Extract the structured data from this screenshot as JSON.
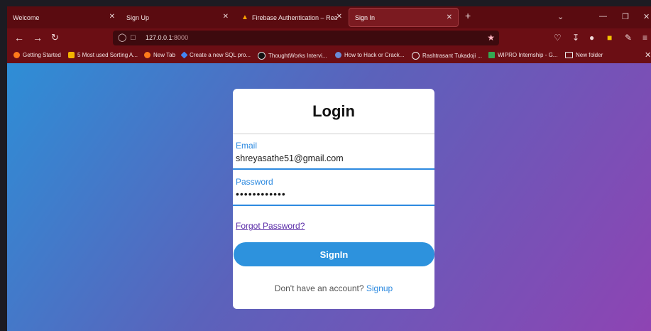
{
  "browser": {
    "tabs": [
      {
        "label": "Welcome"
      },
      {
        "label": "Sign Up"
      },
      {
        "label": "Firebase Authentication – Realtim"
      },
      {
        "label": "Sign In"
      }
    ],
    "url_host": "127.0.0.1",
    "url_port": ":8000",
    "bookmarks": [
      "Getting Started",
      "5 Most used Sorting A...",
      "New Tab",
      "Create a new SQL pro...",
      "ThoughtWorks Intervi...",
      "How to Hack or Crack...",
      "Rashtrasant Tukadoji ...",
      "WIPRO Internship - G...",
      "New folder"
    ]
  },
  "login": {
    "title": "Login",
    "email_label": "Email",
    "email_value": "shreyasathe51@gmail.com",
    "password_label": "Password",
    "password_value": "••••••••••••",
    "forgot_label": "Forgot Password?",
    "signin_label": "SignIn",
    "no_account_text": "Don't have an account?",
    "signup_label": "Signup"
  },
  "colors": {
    "accent": "#2d8ae0",
    "tabbar": "#5a0b10",
    "toolbar": "#6b0e14"
  }
}
